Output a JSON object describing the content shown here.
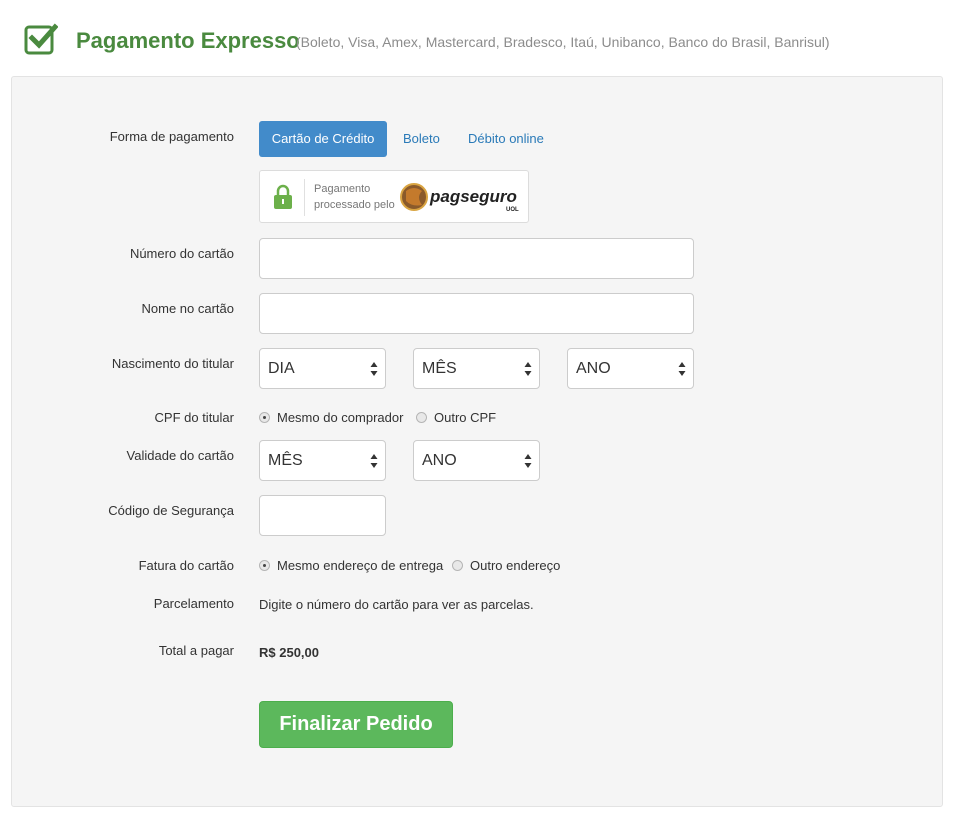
{
  "header": {
    "title": "Pagamento Expresso",
    "subtitle": "(Boleto, Visa, Amex, Mastercard, Bradesco, Itaú, Unibanco, Banco do Brasil, Banrisul)",
    "check_icon": "check-square-icon",
    "brand_color": "#4a8a3f"
  },
  "payment_method": {
    "label": "Forma de pagamento",
    "tabs": [
      {
        "label": "Cartão de Crédito",
        "active": true
      },
      {
        "label": "Boleto",
        "active": false
      },
      {
        "label": "Débito online",
        "active": false
      }
    ],
    "badge": {
      "icon": "lock-icon",
      "text": "Pagamento processado pelo",
      "logo_text": "pagseguro",
      "logo_sub": "UOL"
    }
  },
  "card_number": {
    "label": "Número do cartão",
    "value": "",
    "placeholder": ""
  },
  "card_name": {
    "label": "Nome no cartão",
    "value": "",
    "placeholder": ""
  },
  "birth_date": {
    "label": "Nascimento do titular",
    "day": "DIA",
    "month": "MÊS",
    "year": "ANO"
  },
  "cpf": {
    "label": "CPF do titular",
    "options": [
      {
        "label": "Mesmo do comprador",
        "checked": true
      },
      {
        "label": "Outro CPF",
        "checked": false
      }
    ]
  },
  "validity": {
    "label": "Validade do cartão",
    "month": "MÊS",
    "year": "ANO"
  },
  "security_code": {
    "label": "Código de Segurança",
    "value": ""
  },
  "billing": {
    "label": "Fatura do cartão",
    "options": [
      {
        "label": "Mesmo endereço de entrega",
        "checked": true
      },
      {
        "label": "Outro endereço",
        "checked": false
      }
    ]
  },
  "installments": {
    "label": "Parcelamento",
    "text": "Digite o número do cartão para ver as parcelas."
  },
  "total": {
    "label": "Total a pagar",
    "value": "R$ 250,00"
  },
  "finish_button": {
    "label": "Finalizar Pedido",
    "color": "#5cb85c"
  },
  "colors": {
    "accent": "#428bca",
    "link": "#2a7ab8",
    "panel_bg": "#f5f5f5"
  }
}
